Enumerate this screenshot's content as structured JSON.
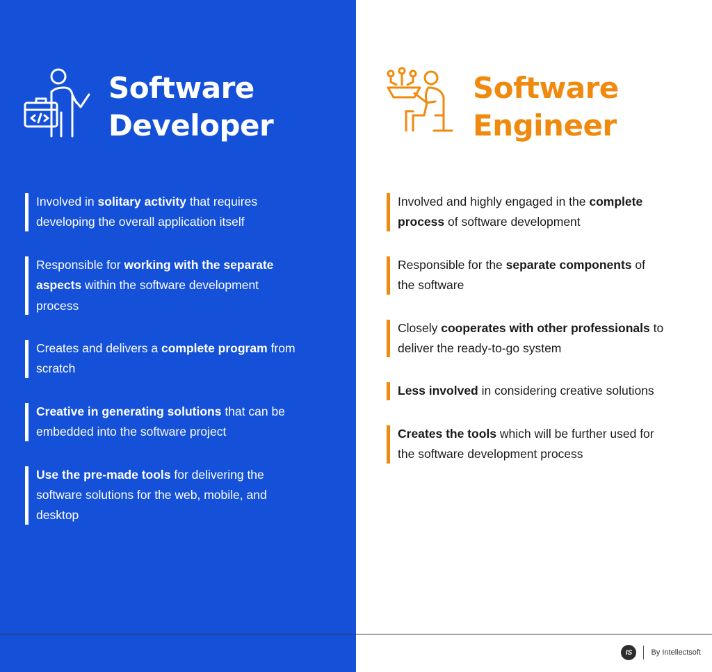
{
  "developer": {
    "title_line1": "Software",
    "title_line2": "Developer",
    "icon": "developer-presenting-code-icon",
    "accent_color": "#ffffff",
    "background_color": "#1450d8",
    "items": [
      {
        "pre": "Involved in ",
        "bold": "solitary activity",
        "post": " that requires developing the overall application itself"
      },
      {
        "pre": "Responsible for ",
        "bold": "working with the separate aspects",
        "post": " within the software development process"
      },
      {
        "pre": "Creates and delivers a ",
        "bold": "complete program",
        "post": " from scratch"
      },
      {
        "pre": "",
        "bold": "Creative in generating solutions",
        "post": " that can be embedded into the software project"
      },
      {
        "pre": "",
        "bold": "Use the pre-made tools",
        "post": " for delivering the software solutions for the web, mobile, and desktop"
      }
    ]
  },
  "engineer": {
    "title_line1": "Software",
    "title_line2": "Engineer",
    "icon": "engineer-at-desk-circuit-icon",
    "accent_color": "#f08a0e",
    "background_color": "#ffffff",
    "items": [
      {
        "pre": "Involved and highly engaged in the ",
        "bold": "complete process",
        "post": " of software development"
      },
      {
        "pre": "Responsible for the ",
        "bold": "separate components",
        "post": " of the software"
      },
      {
        "pre": "Closely ",
        "bold": "cooperates with other professionals",
        "post": " to deliver the ready-to-go system"
      },
      {
        "pre": "",
        "bold": "Less involved",
        "post": " in considering creative solutions"
      },
      {
        "pre": "",
        "bold": "Creates the tools",
        "post": " which will be further used for the software development process"
      }
    ]
  },
  "footer": {
    "logo_text": "IS",
    "credit": "By Intellectsoft"
  }
}
